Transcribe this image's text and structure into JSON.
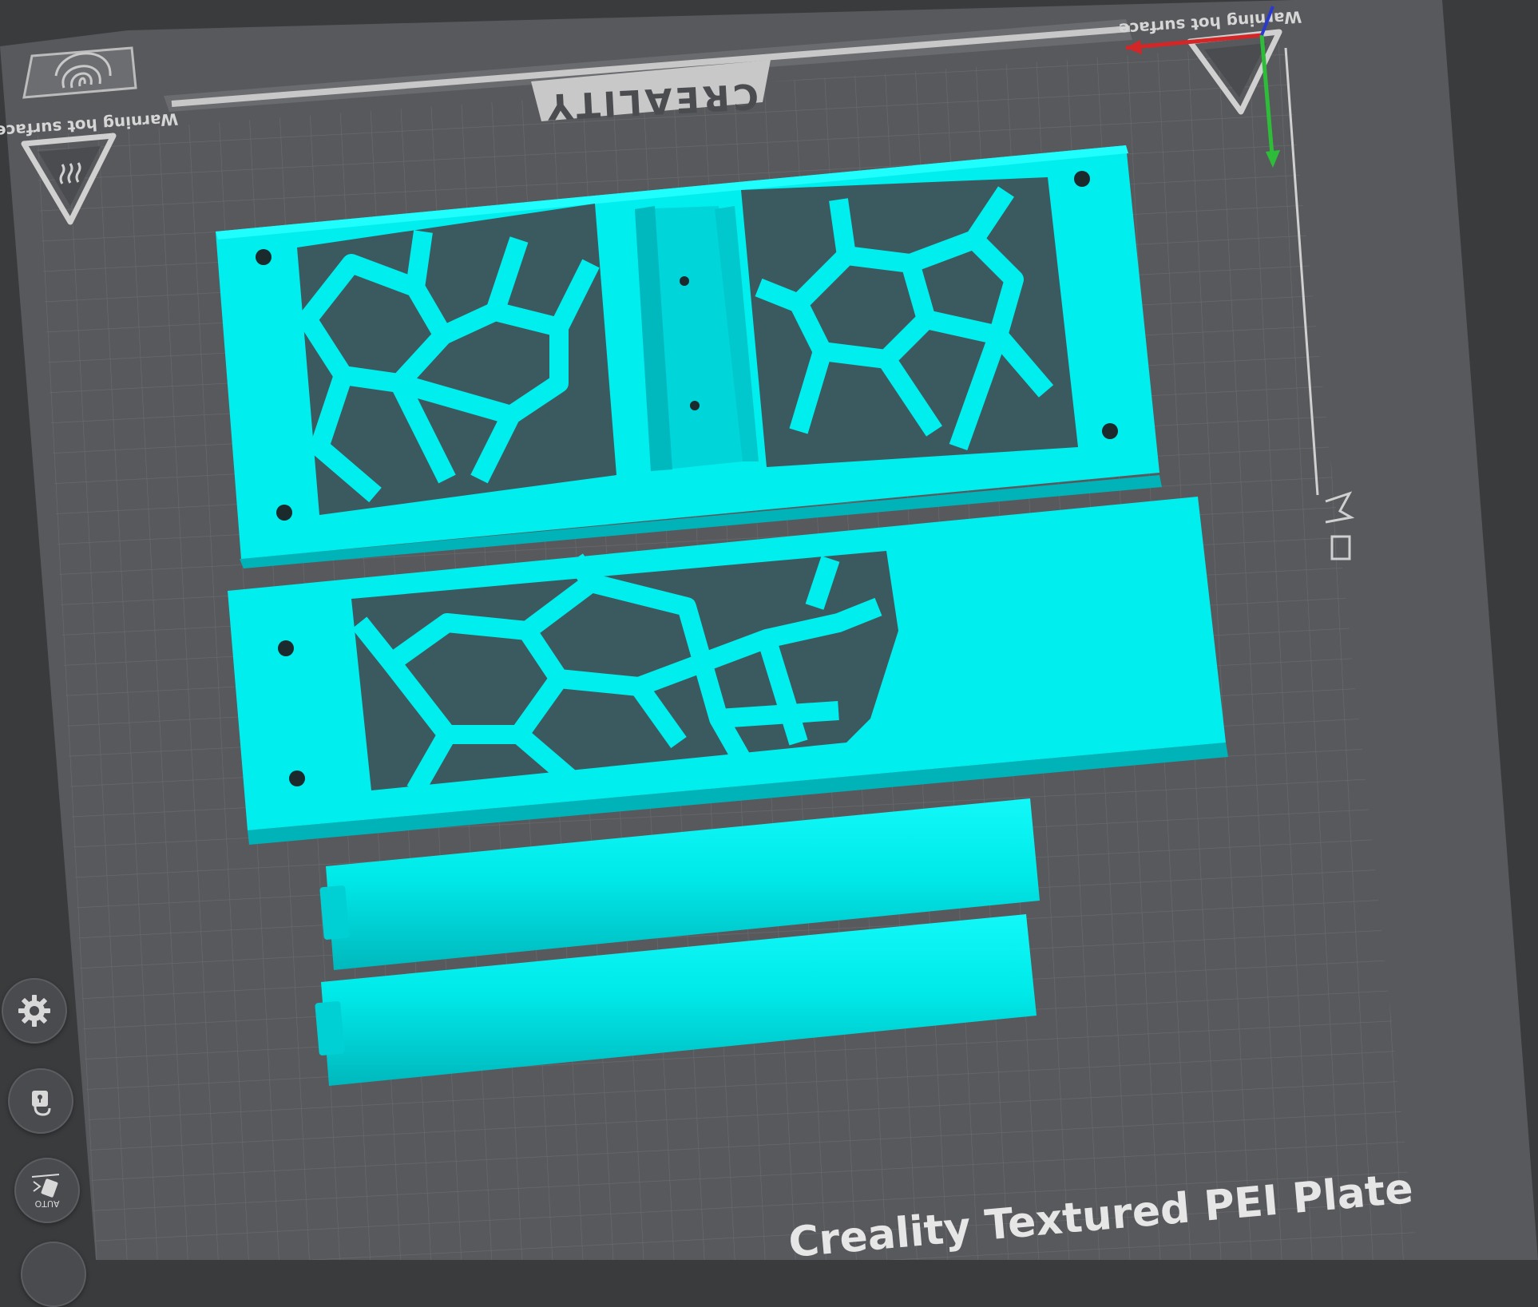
{
  "bed": {
    "brand_logo": "CREALITY",
    "warning_left": "Warning hot surface",
    "warning_right": "Warning hot surface",
    "plate_name": "Creality Textured PEI Plate"
  },
  "toolbar": {
    "settings_icon": "gear-icon",
    "lock_icon": "lock-icon",
    "auto_arrange_icon": "auto-arrange-icon",
    "auto_label": "AUTO"
  },
  "colors": {
    "background": "#3a3b3d",
    "bed": "#58595c",
    "grid_line": "#6c6d71",
    "model": "#00eeee",
    "model_shadow": "#00b3b8",
    "axis_x": "#d42626",
    "axis_y": "#2ebd38",
    "axis_z": "#2a3ad1"
  },
  "models": [
    "fan-grille-plate",
    "voronoi-panel",
    "cylinder-rod",
    "cylinder-rod"
  ]
}
